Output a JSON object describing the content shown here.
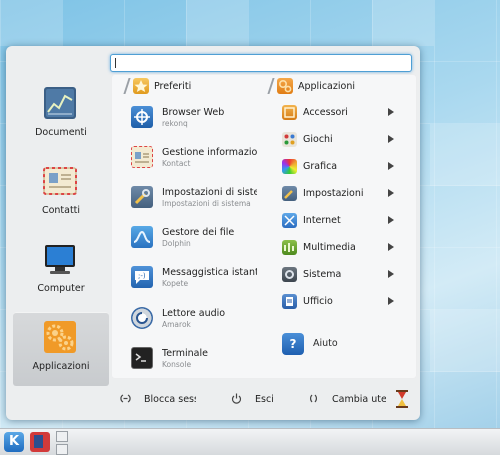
{
  "search": {
    "value": "",
    "placeholder": ""
  },
  "sidebar": [
    {
      "label": "Documenti",
      "icon": "documents-chart-icon"
    },
    {
      "label": "Contatti",
      "icon": "contacts-card-icon"
    },
    {
      "label": "Computer",
      "icon": "computer-monitor-icon"
    },
    {
      "label": "Applicazioni",
      "icon": "applications-gear-icon",
      "active": true
    }
  ],
  "favorites": {
    "header": "Preferiti",
    "items": [
      {
        "title": "Browser Web",
        "subtitle": "rekonq",
        "icon": "browser-icon"
      },
      {
        "title": "Gestione informazioni",
        "subtitle": "Kontact",
        "icon": "kontact-icon"
      },
      {
        "title": "Impostazioni di sistema",
        "subtitle": "Impostazioni di sistema",
        "icon": "system-settings-icon"
      },
      {
        "title": "Gestore dei file",
        "subtitle": "Dolphin",
        "icon": "file-manager-icon"
      },
      {
        "title": "Messaggistica istantanea",
        "subtitle": "Kopete",
        "icon": "instant-messaging-icon"
      },
      {
        "title": "Lettore audio",
        "subtitle": "Amarok",
        "icon": "audio-player-icon"
      },
      {
        "title": "Terminale",
        "subtitle": "Konsole",
        "icon": "terminal-icon"
      }
    ]
  },
  "applications": {
    "header": "Applicazioni",
    "items": [
      {
        "label": "Accessori",
        "icon": "accessories-icon"
      },
      {
        "label": "Giochi",
        "icon": "games-icon"
      },
      {
        "label": "Grafica",
        "icon": "graphics-icon"
      },
      {
        "label": "Impostazioni",
        "icon": "settings-icon"
      },
      {
        "label": "Internet",
        "icon": "internet-icon"
      },
      {
        "label": "Multimedia",
        "icon": "multimedia-icon"
      },
      {
        "label": "Sistema",
        "icon": "system-icon"
      },
      {
        "label": "Ufficio",
        "icon": "office-icon"
      }
    ],
    "help": {
      "label": "Aiuto",
      "glyph": "?"
    }
  },
  "session": {
    "lock": "Blocca sessione",
    "logout": "Esci",
    "switch_user": "Cambia utente"
  },
  "taskbar": {
    "k_glyph": "K"
  },
  "colors": {
    "accent": "#4f9fd4",
    "panel": "#eceeef"
  }
}
